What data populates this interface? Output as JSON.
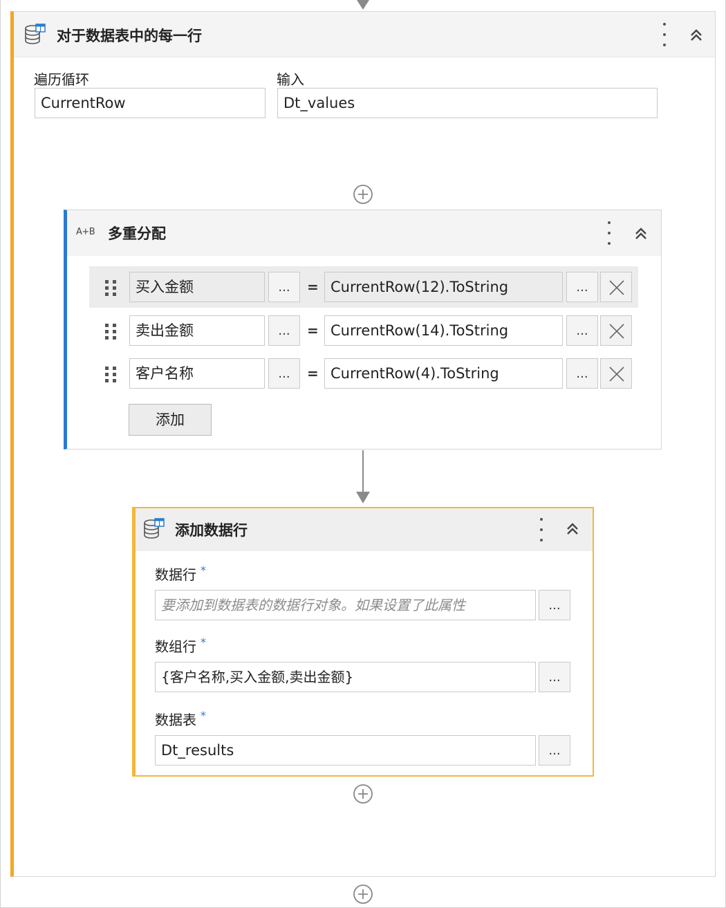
{
  "foreach": {
    "title": "对于数据表中的每一行",
    "loop_label": "遍历循环",
    "loop_value": "CurrentRow",
    "input_label": "输入",
    "input_value": "Dt_values"
  },
  "multi_assign": {
    "icon_text": "A+B",
    "title": "多重分配",
    "rows": [
      {
        "target": "买入金额",
        "ellipsis": "...",
        "equals": "=",
        "value": "CurrentRow(12).ToString",
        "value_ellipsis": "..."
      },
      {
        "target": "卖出金额",
        "ellipsis": "...",
        "equals": "=",
        "value": "CurrentRow(14).ToString",
        "value_ellipsis": "..."
      },
      {
        "target": "客户名称",
        "ellipsis": "...",
        "equals": "=",
        "value": "CurrentRow(4).ToString",
        "value_ellipsis": "..."
      }
    ],
    "add_label": "添加"
  },
  "add_data_row": {
    "title": "添加数据行",
    "datarow_label": "数据行",
    "datarow_placeholder": "要添加到数据表的数据行对象。如果设置了此属性",
    "arrayrow_label": "数组行",
    "arrayrow_value": "{客户名称,买入金额,卖出金额}",
    "datatable_label": "数据表",
    "datatable_value": "Dt_results",
    "required_mark": "*",
    "ellipsis": "..."
  },
  "colors": {
    "foreach_accent": "#f5a623",
    "assign_accent": "#2a7ad2",
    "adddatarow_accent": "#f5b63a"
  },
  "icons": [
    "datatable-icon",
    "kebab-menu-icon",
    "collapse-chevrons-icon",
    "add-activity-plus-icon",
    "drag-grip-icon",
    "delete-x-icon"
  ]
}
